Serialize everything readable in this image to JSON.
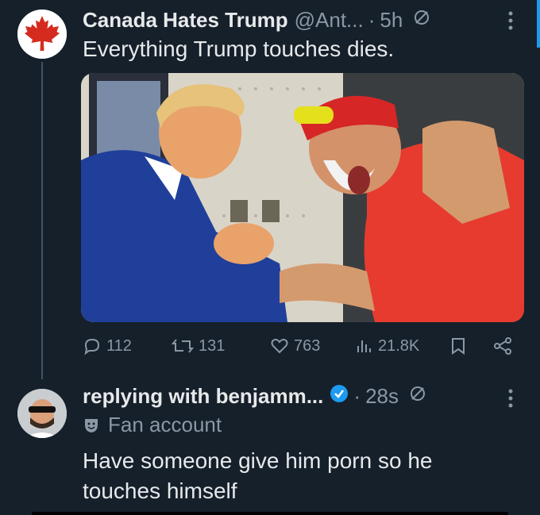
{
  "tweet": {
    "author_name": "Canada Hates Trump",
    "handle": "@Ant...",
    "time": "5h",
    "text": "Everything Trump touches dies.",
    "stats": {
      "replies": "112",
      "reposts": "131",
      "likes": "763",
      "views": "21.8K"
    }
  },
  "reply": {
    "author_name": "replying with benjamm...",
    "time": "28s",
    "label": "Fan account",
    "text": "Have someone give him porn so he touches himself"
  },
  "icons": [
    "maple-leaf-icon",
    "mute-icon",
    "more-icon",
    "reply-icon",
    "repost-icon",
    "like-icon",
    "views-icon",
    "bookmark-icon",
    "share-icon",
    "verified-icon",
    "fan-account-icon"
  ],
  "colors": {
    "background": "#15202b",
    "text": "#e7e9ea",
    "muted": "#8b98a5",
    "accent": "#1d9bf0",
    "canada_red": "#d52b1e"
  }
}
